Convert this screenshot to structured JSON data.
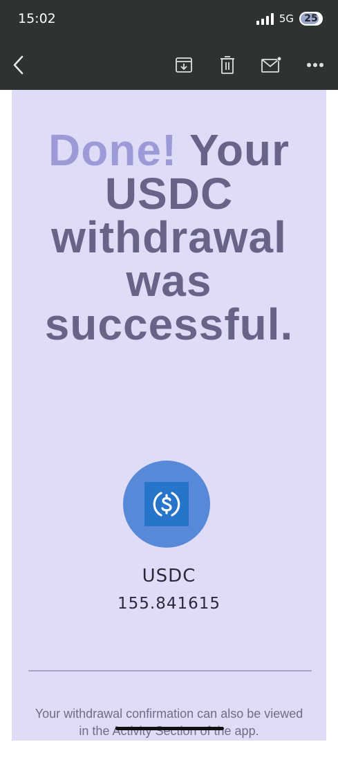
{
  "status_bar": {
    "time": "15:02",
    "network": "5G",
    "battery": "25"
  },
  "toolbar": {
    "icons": [
      "back-icon",
      "archive-icon",
      "trash-icon",
      "mail-icon",
      "more-icon"
    ]
  },
  "email": {
    "headline_accent": "Done!",
    "headline_rest": "Your USDC withdrawal was successful.",
    "token_name": "USDC",
    "amount": "155.841615",
    "footer": "Your withdrawal confirmation can also be viewed in the Activity Section of the app."
  },
  "colors": {
    "email_background": "#dfdcf8",
    "headline": "#676487",
    "headline_accent": "#9c9bd7",
    "coin": "#5889d9",
    "bar": "#2f3233"
  }
}
